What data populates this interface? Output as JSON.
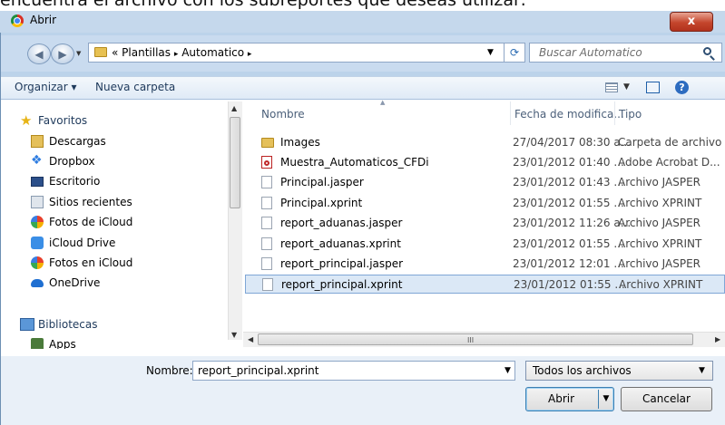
{
  "page_caption": "encuentra el archivo con los subreportes que deseas utilizar:",
  "window": {
    "title": "Abrir",
    "close_label": "x"
  },
  "nav": {
    "breadcrumb_prefix": "«",
    "breadcrumb": [
      "Plantillas",
      "Automatico"
    ],
    "separator": "▸",
    "search_placeholder": "Buscar Automatico"
  },
  "toolbar": {
    "organize_label": "Organizar ▾",
    "new_folder_label": "Nueva carpeta",
    "help_label": "?"
  },
  "sidebar": {
    "favorites_label": "Favoritos",
    "favorites": [
      {
        "label": "Descargas",
        "icon": "downloads-icon",
        "color": "#3b6fb6"
      },
      {
        "label": "Dropbox",
        "icon": "dropbox-icon",
        "color": "#2f7de1"
      },
      {
        "label": "Escritorio",
        "icon": "desktop-icon",
        "color": "#2b4f8a"
      },
      {
        "label": "Sitios recientes",
        "icon": "recent-places-icon",
        "color": "#8a9bb0"
      },
      {
        "label": "Fotos de iCloud",
        "icon": "icloud-photos-icon",
        "color": "#e88a2d"
      },
      {
        "label": "iCloud Drive",
        "icon": "icloud-drive-icon",
        "color": "#3a8ee6"
      },
      {
        "label": "Fotos en iCloud",
        "icon": "icloud-photos-icon",
        "color": "#e88a2d"
      },
      {
        "label": "OneDrive",
        "icon": "onedrive-icon",
        "color": "#1f6fd1"
      }
    ],
    "libraries_label": "Bibliotecas",
    "libraries": [
      {
        "label": "Apps",
        "icon": "apps-icon",
        "color": "#4a7a3a"
      }
    ]
  },
  "file_list": {
    "columns": [
      "Nombre",
      "Fecha de modifica...",
      "Tipo"
    ],
    "rows": [
      {
        "name": "Images",
        "date": "27/04/2017 08:30 a...",
        "type": "Carpeta de archivo",
        "icon": "folder-icon",
        "selected": false
      },
      {
        "name": "Muestra_Automaticos_CFDi",
        "date": "23/01/2012 01:40 ...",
        "type": "Adobe Acrobat D...",
        "icon": "pdf-icon",
        "selected": false
      },
      {
        "name": "Principal.jasper",
        "date": "23/01/2012 01:43 ...",
        "type": "Archivo JASPER",
        "icon": "file-icon",
        "selected": false
      },
      {
        "name": "Principal.xprint",
        "date": "23/01/2012 01:55 ...",
        "type": "Archivo XPRINT",
        "icon": "file-icon",
        "selected": false
      },
      {
        "name": "report_aduanas.jasper",
        "date": "23/01/2012 11:26 a...",
        "type": "Archivo JASPER",
        "icon": "file-icon",
        "selected": false
      },
      {
        "name": "report_aduanas.xprint",
        "date": "23/01/2012 01:55 ...",
        "type": "Archivo XPRINT",
        "icon": "file-icon",
        "selected": false
      },
      {
        "name": "report_principal.jasper",
        "date": "23/01/2012 12:01 ...",
        "type": "Archivo JASPER",
        "icon": "file-icon",
        "selected": false
      },
      {
        "name": "report_principal.xprint",
        "date": "23/01/2012 01:55 ...",
        "type": "Archivo XPRINT",
        "icon": "file-icon",
        "selected": true
      }
    ]
  },
  "footer": {
    "name_label": "Nombre:",
    "name_value": "report_principal.xprint",
    "filter_value": "Todos los archivos",
    "open_label": "Abrir",
    "cancel_label": "Cancelar"
  },
  "colors": {
    "selection": "#dbe8f6",
    "selection_border": "#7fa6d6",
    "close_button": "#c4452c",
    "chrome": "#c5d8ec"
  }
}
